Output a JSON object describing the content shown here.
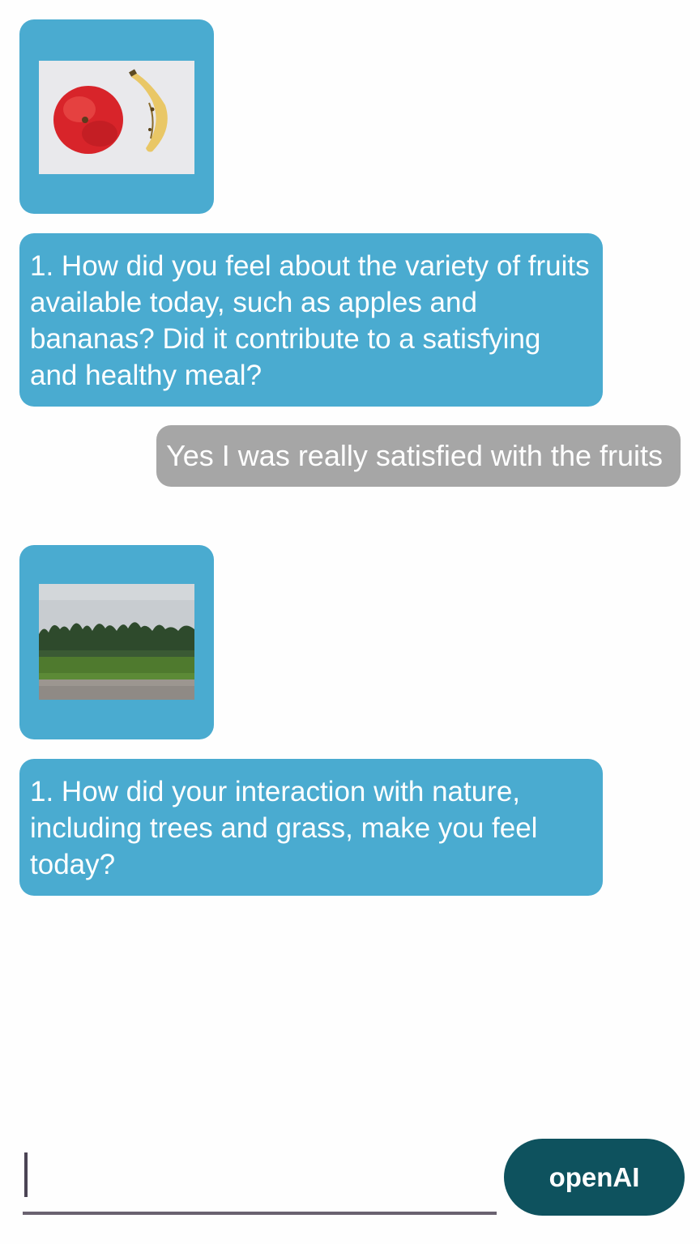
{
  "messages": [
    {
      "type": "image",
      "role": "bot",
      "subject": "apple and banana"
    },
    {
      "type": "text",
      "role": "bot",
      "text": "1. How did you feel about the variety of fruits available today, such as apples and bananas? Did it contribute to a satisfying and healthy meal?"
    },
    {
      "type": "text",
      "role": "user",
      "text": "Yes I was really satisfied with the fruits"
    },
    {
      "type": "image",
      "role": "bot",
      "subject": "trees and grass landscape"
    },
    {
      "type": "text",
      "role": "bot",
      "text": "1. How did your interaction with nature, including trees and grass, make you feel today?"
    }
  ],
  "composer": {
    "input_value": "",
    "send_label": "openAI"
  },
  "colors": {
    "bot_bubble": "#4aabd0",
    "user_bubble": "#a6a6a6",
    "send_button": "#0e525e",
    "background": "#fefefe"
  }
}
